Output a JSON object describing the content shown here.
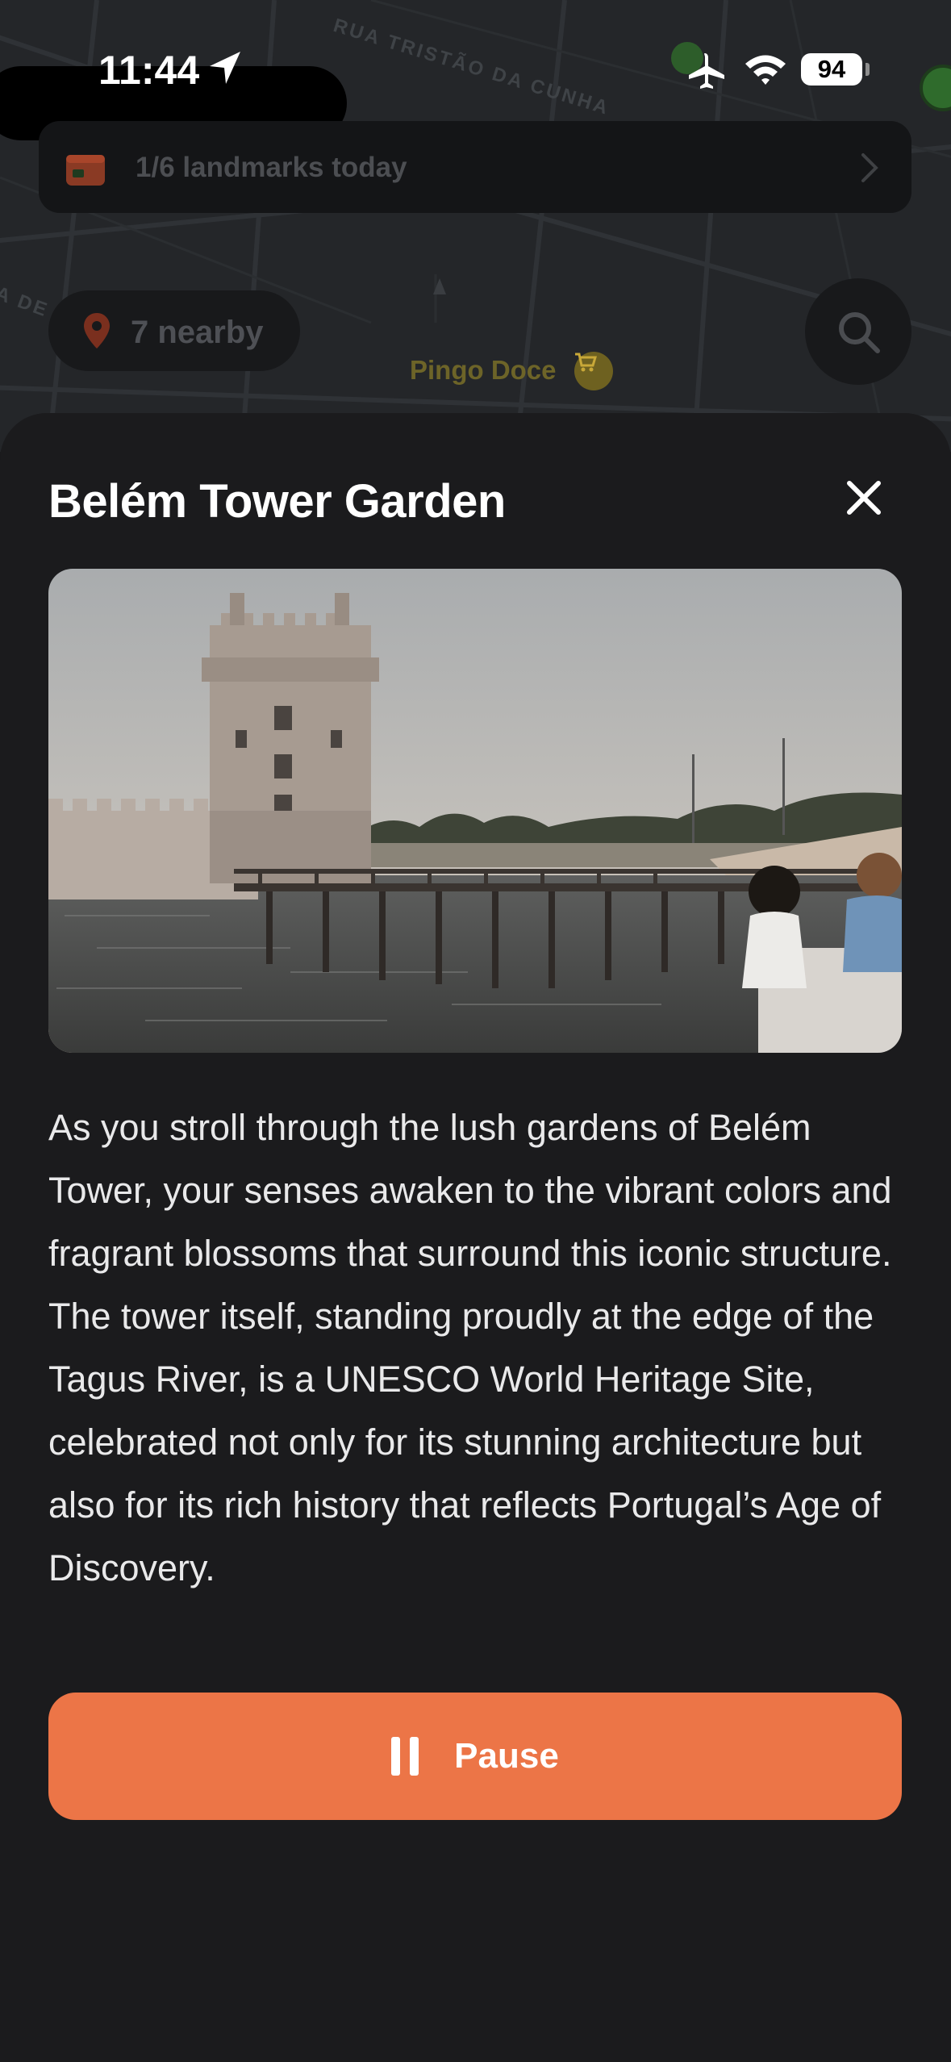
{
  "status_bar": {
    "time": "11:44",
    "battery": "94",
    "icons": [
      "location-arrow-icon",
      "airplane-icon",
      "wifi-icon",
      "battery-icon"
    ]
  },
  "map": {
    "street_label": "RUA TRISTÃO DA CUNHA",
    "street_label_left": "A DE",
    "poi_label": "Pingo Doce",
    "poi_icon": "shopping-cart-icon"
  },
  "banner": {
    "icon": "calendar-icon",
    "text": "1/6 landmarks today",
    "chevron": "chevron-right-icon"
  },
  "nearby": {
    "icon": "map-pin-icon",
    "text": "7 nearby"
  },
  "search": {
    "icon": "search-icon"
  },
  "sheet": {
    "title": "Belém Tower Garden",
    "close_icon": "close-icon",
    "photo_alt": "Belém Tower with wooden pier over water",
    "description": "As you stroll through the lush gardens of Belém Tower, your senses awaken to the vibrant colors and fragrant blossoms that surround this iconic structure. The tower itself, standing proudly at the edge of the Tagus River, is a UNESCO World Heritage Site, celebrated not only for its stunning architecture but also for its rich history that reflects Portugal’s Age of Discovery.",
    "pause_label": "Pause",
    "pause_icon": "pause-icon"
  },
  "colors": {
    "accent": "#ec7547",
    "sheet_bg": "#1b1b1d",
    "map_bg": "#242629"
  }
}
